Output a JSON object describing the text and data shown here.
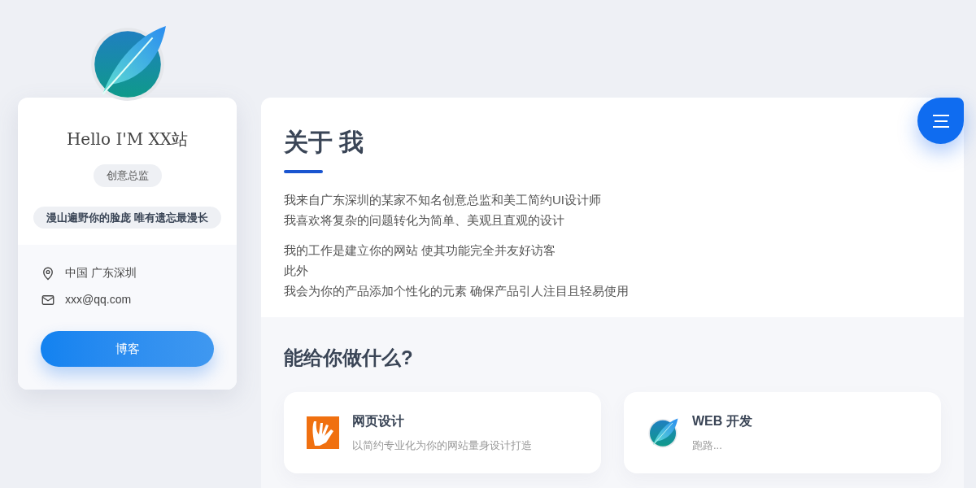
{
  "profile": {
    "greeting": "Hello I'M XX站",
    "role": "创意总监",
    "motto": "漫山遍野你的脸庞 唯有遗忘最漫长",
    "location": "中国 广东深圳",
    "email": "xxx@qq.com",
    "button": "博客"
  },
  "about": {
    "title": "关于 我",
    "paragraphs": [
      [
        "我来自广东深圳的某家不知名创意总监和美工简约UI设计师",
        "我喜欢将复杂的问题转化为简单、美观且直观的设计"
      ],
      [
        "我的工作是建立你的网站 使其功能完全并友好访客",
        "此外",
        "我会为你的产品添加个性化的元素 确保产品引人注目且轻易使用"
      ]
    ]
  },
  "services": {
    "title": "能给你做什么?",
    "items": [
      {
        "kind": "hand",
        "title": "网页设计",
        "description": "以简约专业化为你的网站量身设计打造"
      },
      {
        "kind": "feather",
        "title": "WEB 开发",
        "description": "跑路..."
      }
    ]
  }
}
